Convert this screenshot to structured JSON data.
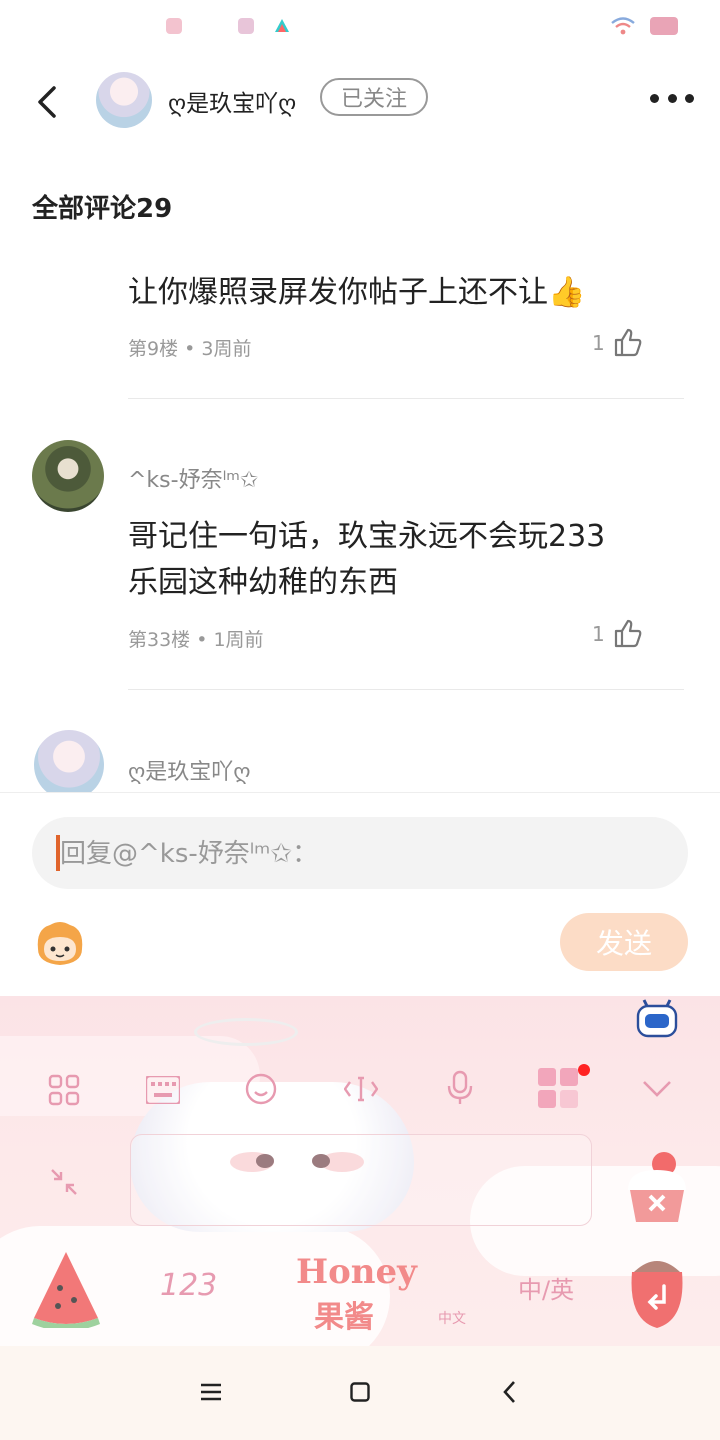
{
  "header": {
    "username": "ღ是玖宝吖ღ",
    "follow_label": "已关注",
    "back_icon": "chevron-left-icon",
    "more_icon": "more-dots-icon"
  },
  "comments_title": "全部评论29",
  "comments": [
    {
      "text": "让你爆照录屏发你帖子上还不让👍",
      "meta": "第9楼 • 3周前",
      "likes": "1"
    },
    {
      "author": "^ks-妤奈ˡᵐ✩",
      "text_line1": "哥记住一句话，玖宝永远不会玩233",
      "text_line2": "乐园这种幼稚的东西",
      "meta": "第33楼 • 1周前",
      "likes": "1"
    },
    {
      "author": "ღ是玖宝吖ღ"
    }
  ],
  "reply": {
    "placeholder": "回复@^ks-妤奈ˡᵐ✩：",
    "send_label": "发送"
  },
  "keyboard": {
    "numeric_key": "123",
    "lang_key": "中/英",
    "brand_line1": "Honey",
    "brand_line2": "果酱",
    "brand_sub": "中文"
  },
  "colors": {
    "accent": "#e0642c",
    "send_disabled": "#fcdcc6",
    "keyboard_icon": "#e79ab0"
  }
}
